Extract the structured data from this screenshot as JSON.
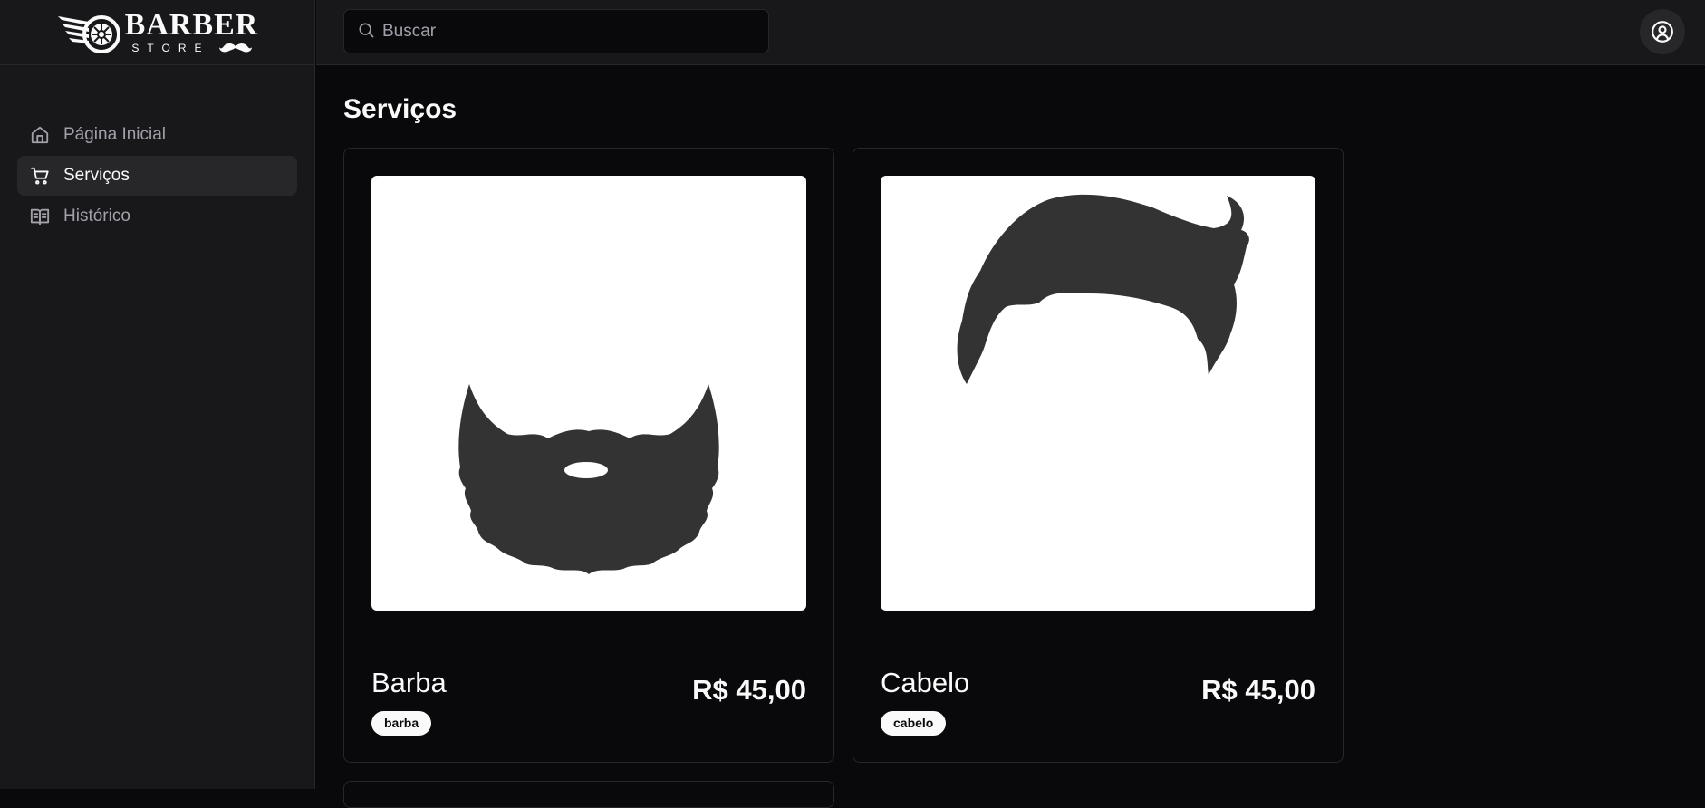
{
  "brand": {
    "logo_text": "BARBER",
    "logo_subtext": "STORE"
  },
  "sidebar": {
    "items": [
      {
        "label": "Página Inicial",
        "icon": "home-icon",
        "active": false
      },
      {
        "label": "Serviços",
        "icon": "cart-icon",
        "active": true
      },
      {
        "label": "Histórico",
        "icon": "book-open-icon",
        "active": false
      }
    ]
  },
  "search": {
    "placeholder": "Buscar",
    "value": ""
  },
  "header": {
    "user_icon": "user-circle-icon"
  },
  "main": {
    "title": "Serviços",
    "services": [
      {
        "name": "Barba",
        "price": "R$ 45,00",
        "tag": "barba",
        "image_icon": "beard-icon"
      },
      {
        "name": "Cabelo",
        "price": "R$ 45,00",
        "tag": "cabelo",
        "image_icon": "hair-icon"
      }
    ]
  },
  "colors": {
    "background": "#09090b",
    "panel": "#18181b",
    "border": "#27272a",
    "text": "#fafafa",
    "muted": "#a1a1aa",
    "illustration": "#333333"
  }
}
